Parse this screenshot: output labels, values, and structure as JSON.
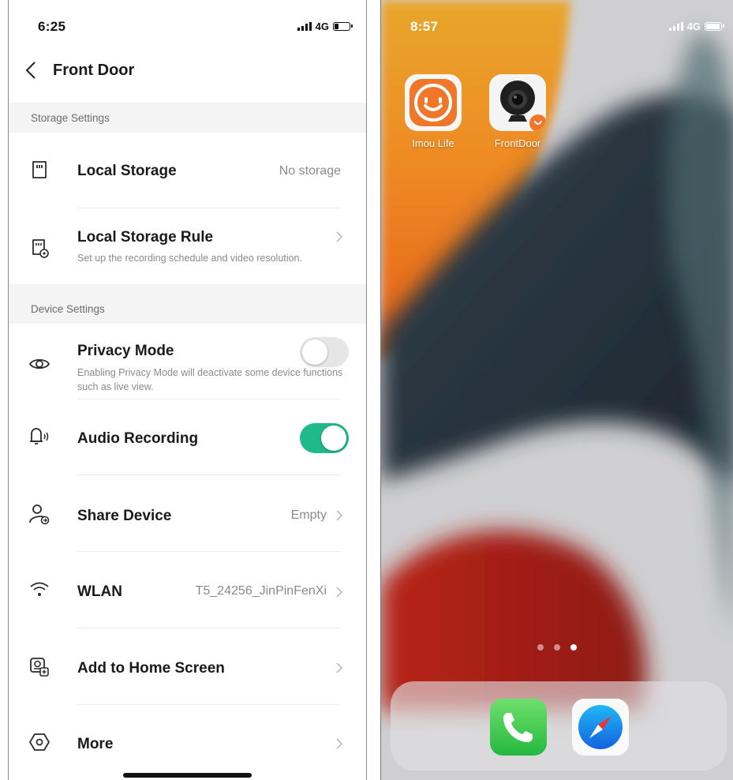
{
  "left_phone": {
    "status": {
      "time": "6:25",
      "network": "4G"
    },
    "header": {
      "title": "Front Door"
    },
    "sections": {
      "storage": "Storage Settings",
      "device": "Device Settings"
    },
    "rows": {
      "local_storage": {
        "label": "Local Storage",
        "value": "No storage"
      },
      "local_storage_rule": {
        "label": "Local Storage Rule",
        "desc": "Set up the recording schedule and video resolution."
      },
      "privacy_mode": {
        "label": "Privacy Mode",
        "desc": "Enabling Privacy Mode will deactivate some device functions such as live view.",
        "enabled": false
      },
      "audio_recording": {
        "label": "Audio Recording",
        "enabled": true
      },
      "share_device": {
        "label": "Share Device",
        "value": "Empty"
      },
      "wlan": {
        "label": "WLAN",
        "value": "T5_24256_JinPinFenXi"
      },
      "add_home": {
        "label": "Add to Home Screen"
      },
      "more": {
        "label": "More"
      }
    },
    "colors": {
      "toggle_on": "#1fb98a",
      "toggle_off": "#e6e6e6"
    }
  },
  "right_phone": {
    "status": {
      "time": "8:57",
      "network": "4G"
    },
    "apps": [
      {
        "name": "Imou Life",
        "icon": "imou-life-app-icon"
      },
      {
        "name": "FrontDoor",
        "icon": "camera-shortcut-icon"
      }
    ],
    "page_dots": {
      "count": 3,
      "active": 3
    },
    "dock": [
      {
        "icon": "phone-app-icon"
      },
      {
        "icon": "safari-app-icon"
      }
    ]
  }
}
